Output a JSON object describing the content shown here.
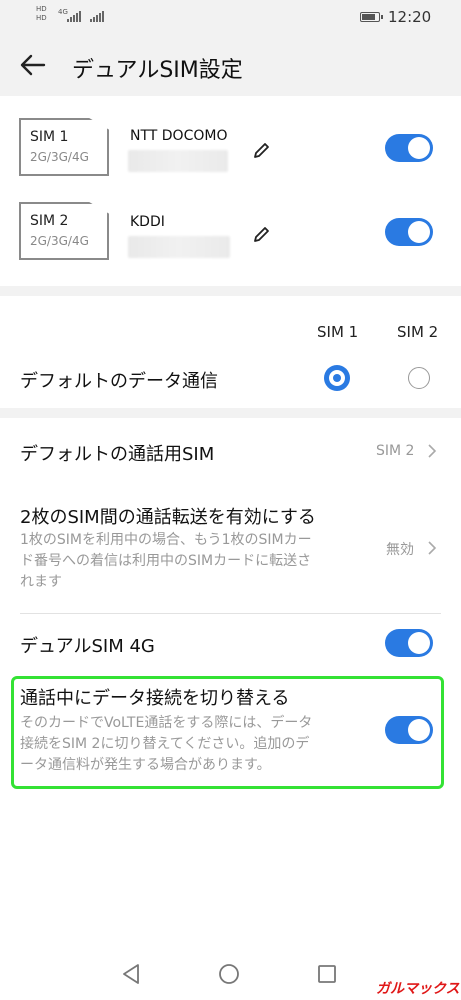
{
  "status_bar": {
    "time": "12:20",
    "sim1_tag": "HD",
    "sim2_tag": "HD",
    "net_type": "4G",
    "battery_icon": "battery-icon"
  },
  "header": {
    "title": "デュアルSIM設定",
    "back_icon": "back-arrow-icon"
  },
  "sims": [
    {
      "slot": "SIM 1",
      "bands": "2G/3G/4G",
      "carrier": "NTT DOCOMO",
      "enabled": true
    },
    {
      "slot": "SIM 2",
      "bands": "2G/3G/4G",
      "carrier": "KDDI",
      "enabled": true
    }
  ],
  "default_data": {
    "col1": "SIM 1",
    "col2": "SIM 2",
    "label": "デフォルトのデータ通信",
    "selected": "SIM 1"
  },
  "default_call": {
    "label": "デフォルトの通話用SIM",
    "value": "SIM 2"
  },
  "call_forward": {
    "label": "2枚のSIM間の通話転送を有効にする",
    "desc_lines": [
      "1枚のSIMを利用中の場合、もう1枚のSIMカー",
      "ド番号への着信は利用中のSIMカードに転送さ",
      "れます"
    ],
    "value": "無効"
  },
  "dual_4g": {
    "label": "デュアルSIM 4G",
    "enabled": true
  },
  "switch_data": {
    "label": "通話中にデータ接続を切り替える",
    "desc_lines": [
      "そのカードでVoLTE通話をする際には、データ",
      "接続をSIM 2に切り替えてください。追加のデ",
      "ータ通信料が発生する場合があります。"
    ],
    "enabled": true
  },
  "nav": {
    "back": "nav-back-icon",
    "home": "nav-home-icon",
    "recents": "nav-recents-icon"
  },
  "watermark": "ガルマックス",
  "colors": {
    "accent": "#2a7ae2",
    "highlight": "#34e234"
  }
}
